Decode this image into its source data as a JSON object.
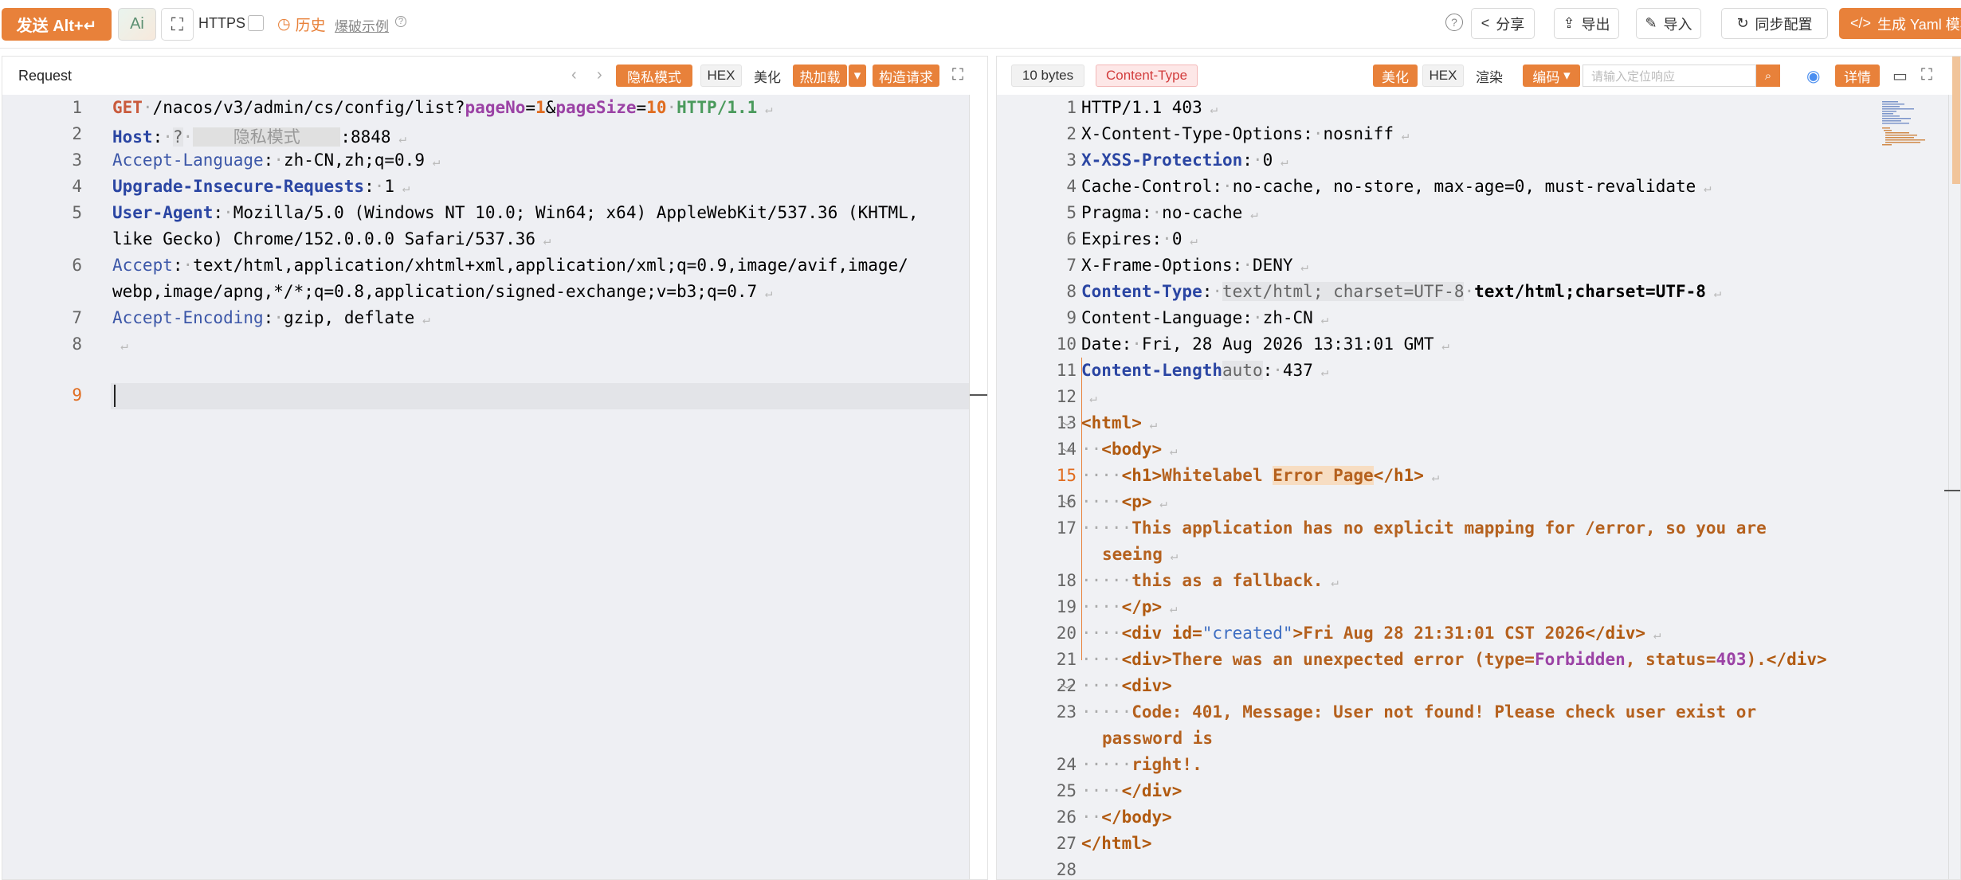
{
  "toolbar": {
    "send_label": "发送 Alt+↵",
    "ai_label": "Ai",
    "scan_glyph": "⛶",
    "https_label": "HTTPS",
    "history_label": "历史",
    "history_glyph": "◷",
    "blast_label": "爆破示例",
    "blast_help_glyph": "?",
    "help_glyph": "?",
    "share_label": "分享",
    "export_label": "导出",
    "import_label": "导入",
    "sync_label": "同步配置",
    "yaml_label": "生成 Yaml 模板"
  },
  "request": {
    "title": "Request",
    "buttons": {
      "private": "隐私模式",
      "hex": "HEX",
      "beautify": "美化",
      "hotload": "热加载",
      "build": "构造请求"
    },
    "mask_label": "隐私模式",
    "lines": [
      {
        "n": "1",
        "method": "GET",
        "path": "/nacos/v3/admin/cs/config/list?",
        "p1": "pageNo",
        "v1": "1",
        "p2": "pageSize",
        "v2": "10",
        "proto": "HTTP/1.1"
      },
      {
        "n": "2",
        "key": "Host",
        "q": "?",
        "port": ":8848"
      },
      {
        "n": "3",
        "key": "Accept-Language",
        "val": "zh-CN,zh;q=0.9"
      },
      {
        "n": "4",
        "key": "Upgrade-Insecure-Requests",
        "val": "1"
      },
      {
        "n": "5",
        "key": "User-Agent",
        "val": "Mozilla/5.0 (Windows NT 10.0; Win64; x64) AppleWebKit/537.36 (KHTML,",
        "val2": "like Gecko) Chrome/152.0.0.0 Safari/537.36"
      },
      {
        "n": "6",
        "key": "Accept",
        "val": "text/html,application/xhtml+xml,application/xml;q=0.9,image/avif,image/",
        "val2": "webp,image/apng,*/*;q=0.8,application/signed-exchange;v=b3;q=0.7"
      },
      {
        "n": "7",
        "key": "Accept-Encoding",
        "val": "gzip, deflate"
      },
      {
        "n": "8"
      },
      {
        "n": "9"
      }
    ]
  },
  "response": {
    "size": "10 bytes",
    "content_type_chip": "Content-Type",
    "buttons": {
      "beautify": "美化",
      "hex": "HEX",
      "render": "渲染",
      "encoding": "编码",
      "search_placeholder": "请输入定位响应",
      "detail": "详情"
    },
    "lines": [
      {
        "n": "1",
        "text": "HTTP/1.1 403"
      },
      {
        "n": "2",
        "key": "X-Content-Type-Options",
        "val": "nosniff"
      },
      {
        "n": "3",
        "key": "X-XSS-Protection",
        "val": "0"
      },
      {
        "n": "4",
        "key": "Cache-Control",
        "val": "no-cache, no-store, max-age=0, must-revalidate"
      },
      {
        "n": "5",
        "key": "Pragma",
        "val": "no-cache"
      },
      {
        "n": "6",
        "key": "Expires",
        "val": "0"
      },
      {
        "n": "7",
        "key": "X-Frame-Options",
        "val": "DENY"
      },
      {
        "n": "8",
        "key": "Content-Type",
        "pill": "text/html; charset=UTF-8",
        "val": "text/html;charset=UTF-8"
      },
      {
        "n": "9",
        "key": "Content-Language",
        "val": "zh-CN"
      },
      {
        "n": "10",
        "key": "Date",
        "val": "Fri, 28 Aug 2026 13:31:01 GMT"
      },
      {
        "n": "11",
        "key": "Content-Length",
        "pill": "auto",
        "val": "437"
      },
      {
        "n": "12"
      },
      {
        "n": "13",
        "html": "<html>"
      },
      {
        "n": "14",
        "html": "<body>"
      },
      {
        "n": "15",
        "h1o": "<h1>",
        "h1a": "Whitelabel ",
        "h1b": "Error Page",
        "h1c": "</h1>"
      },
      {
        "n": "16",
        "html": "<p>"
      },
      {
        "n": "17",
        "text": "This application has no explicit mapping for /error, so you are",
        "text2": "seeing"
      },
      {
        "n": "18",
        "text": "this as a fallback."
      },
      {
        "n": "19",
        "html": "</p>"
      },
      {
        "n": "20",
        "d1": "<div ",
        "attr": "id=",
        "str": "\"created\"",
        "d2": ">",
        "d3": "Fri Aug 28 21:31:01 CST 2026",
        "d4": "</div>"
      },
      {
        "n": "21",
        "e1": "<div>",
        "e2": "There was an unexpected error (type=",
        "e3": "Forbidden",
        "e4": ", status=",
        "e5": "403",
        "e6": ").",
        "e7": "</div>"
      },
      {
        "n": "22",
        "html": "<div>"
      },
      {
        "n": "23",
        "text": "Code: 401, Message: User not found! Please check user exist or",
        "text2": "password is"
      },
      {
        "n": "24",
        "text": "right!."
      },
      {
        "n": "25",
        "html": "</div>"
      },
      {
        "n": "26",
        "html": "</body>"
      },
      {
        "n": "27",
        "html": "</html>"
      },
      {
        "n": "28"
      }
    ]
  }
}
